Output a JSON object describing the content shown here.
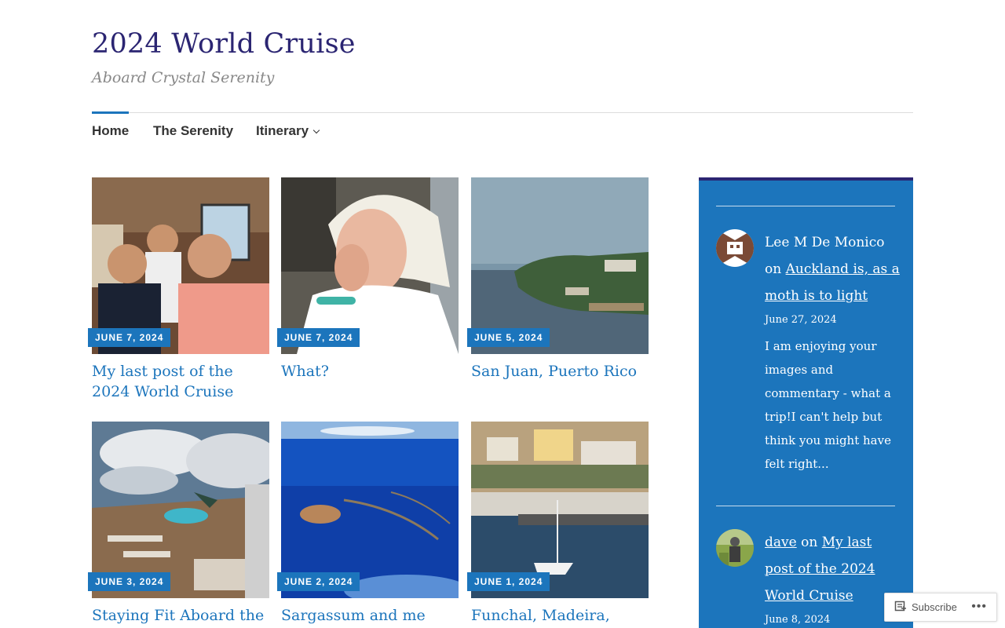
{
  "site": {
    "title": "2024 World Cruise",
    "tagline": "Aboard Crystal Serenity"
  },
  "nav": {
    "items": [
      {
        "label": "Home",
        "active": true
      },
      {
        "label": "The Serenity"
      },
      {
        "label": "Itinerary",
        "has_dropdown": true
      }
    ]
  },
  "posts": [
    {
      "date": "JUNE 7, 2024",
      "title": "My last post of the 2024 World Cruise"
    },
    {
      "date": "JUNE 7, 2024",
      "title": "What?"
    },
    {
      "date": "JUNE 5, 2024",
      "title": "San Juan, Puerto Rico"
    },
    {
      "date": "JUNE 3, 2024",
      "title": "Staying Fit Aboard the"
    },
    {
      "date": "JUNE 2, 2024",
      "title": "Sargassum and me"
    },
    {
      "date": "JUNE 1, 2024",
      "title": "Funchal, Madeira,"
    }
  ],
  "sidebar": {
    "comments": [
      {
        "author": "Lee M De Monico",
        "on": "on",
        "post_link": "Auckland is, as a moth is to light",
        "date": "June 27, 2024",
        "excerpt": "I am enjoying your images and commentary - what a trip!I can't help but think you might have felt right..."
      },
      {
        "author": "dave",
        "on": "on",
        "post_link": "My last post of the 2024 World Cruise",
        "date": "June 8, 2024"
      }
    ]
  },
  "subscribe": {
    "label": "Subscribe",
    "more": "•••"
  },
  "colors": {
    "accent": "#1c75bc",
    "title": "#2b2572"
  },
  "icons": [
    "chevron-down-icon",
    "reader-subscribe-icon",
    "more-options-icon"
  ]
}
